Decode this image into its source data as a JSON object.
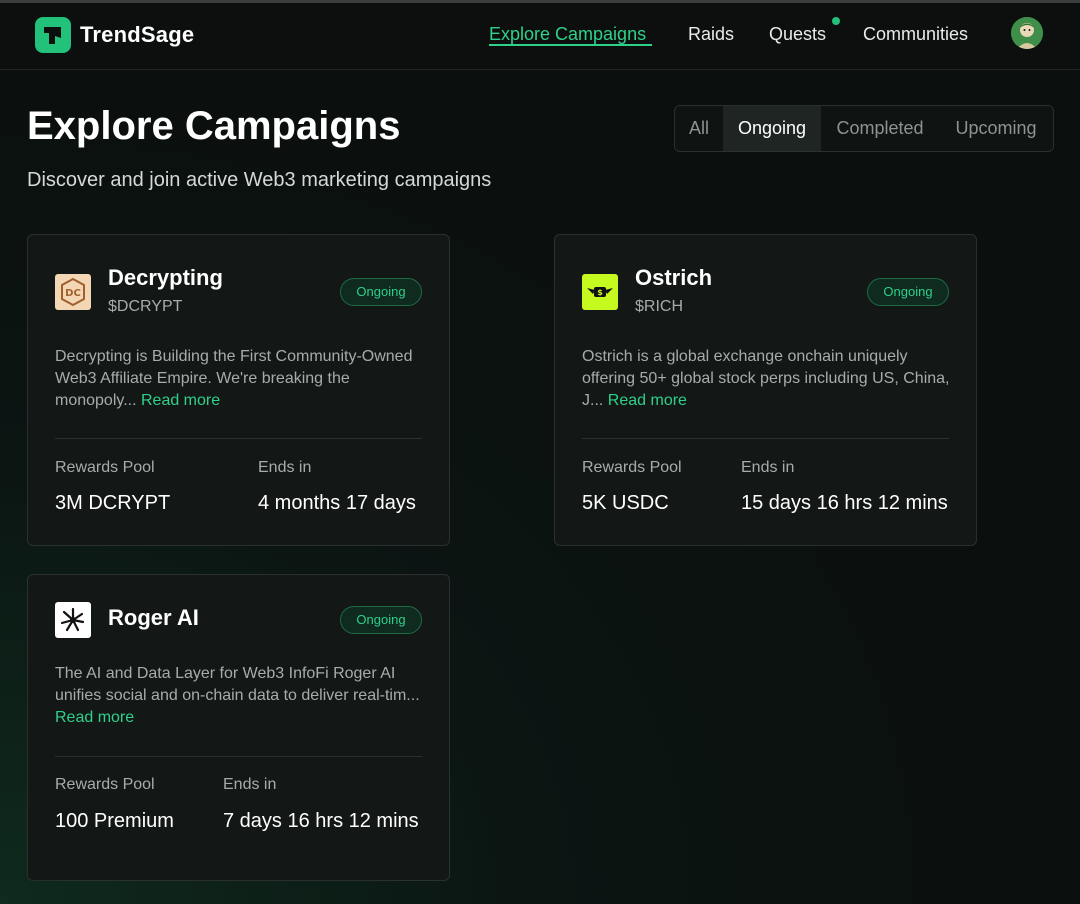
{
  "header": {
    "brand": "TrendSage",
    "nav": {
      "explore": "Explore Campaigns",
      "raids": "Raids",
      "quests": "Quests",
      "communities": "Communities"
    }
  },
  "page": {
    "title": "Explore Campaigns",
    "subtitle": "Discover and join active Web3 marketing campaigns"
  },
  "filters": {
    "all": "All",
    "ongoing": "Ongoing",
    "completed": "Completed",
    "upcoming": "Upcoming",
    "selected": "Ongoing"
  },
  "campaigns": [
    {
      "name": "Decrypting",
      "ticker": "$DCRYPT",
      "status": "Ongoing",
      "description": "Decrypting is Building the First Community-Owned Web3 Affiliate Empire. We're breaking the monopoly...",
      "read_more": "Read more",
      "rewards_label": "Rewards Pool",
      "rewards_value": "3M DCRYPT",
      "ends_label": "Ends in",
      "ends_value": "4 months 17 days"
    },
    {
      "name": "Ostrich",
      "ticker": "$RICH",
      "status": "Ongoing",
      "description": "Ostrich is a global exchange onchain uniquely offering 50+ global stock perps including US, China, J...",
      "read_more": "Read more",
      "rewards_label": "Rewards Pool",
      "rewards_value": "5K USDC",
      "ends_label": "Ends in",
      "ends_value": "15 days 16 hrs 12 mins"
    },
    {
      "name": "Roger AI",
      "ticker": "",
      "status": "Ongoing",
      "description": "The AI and Data Layer for Web3 InfoFi Roger AI unifies social and on-chain data to deliver real-tim...",
      "read_more": "Read more",
      "rewards_label": "Rewards Pool",
      "rewards_value": "100 Premium",
      "ends_label": "Ends in",
      "ends_value": "7 days 16 hrs 12 mins"
    }
  ],
  "colors": {
    "accent": "#2fd08a",
    "background": "#0b0f0d",
    "card": "#131816",
    "ostrich_logo": "#c6f91f",
    "decrypting_logo": "#f3d6b3"
  },
  "icons": {
    "brand_logo": "trendsage-logo-icon",
    "avatar": "user-avatar",
    "decrypting": "decrypting-logo-icon",
    "ostrich": "ostrich-logo-icon",
    "roger": "roger-ai-logo-icon"
  }
}
